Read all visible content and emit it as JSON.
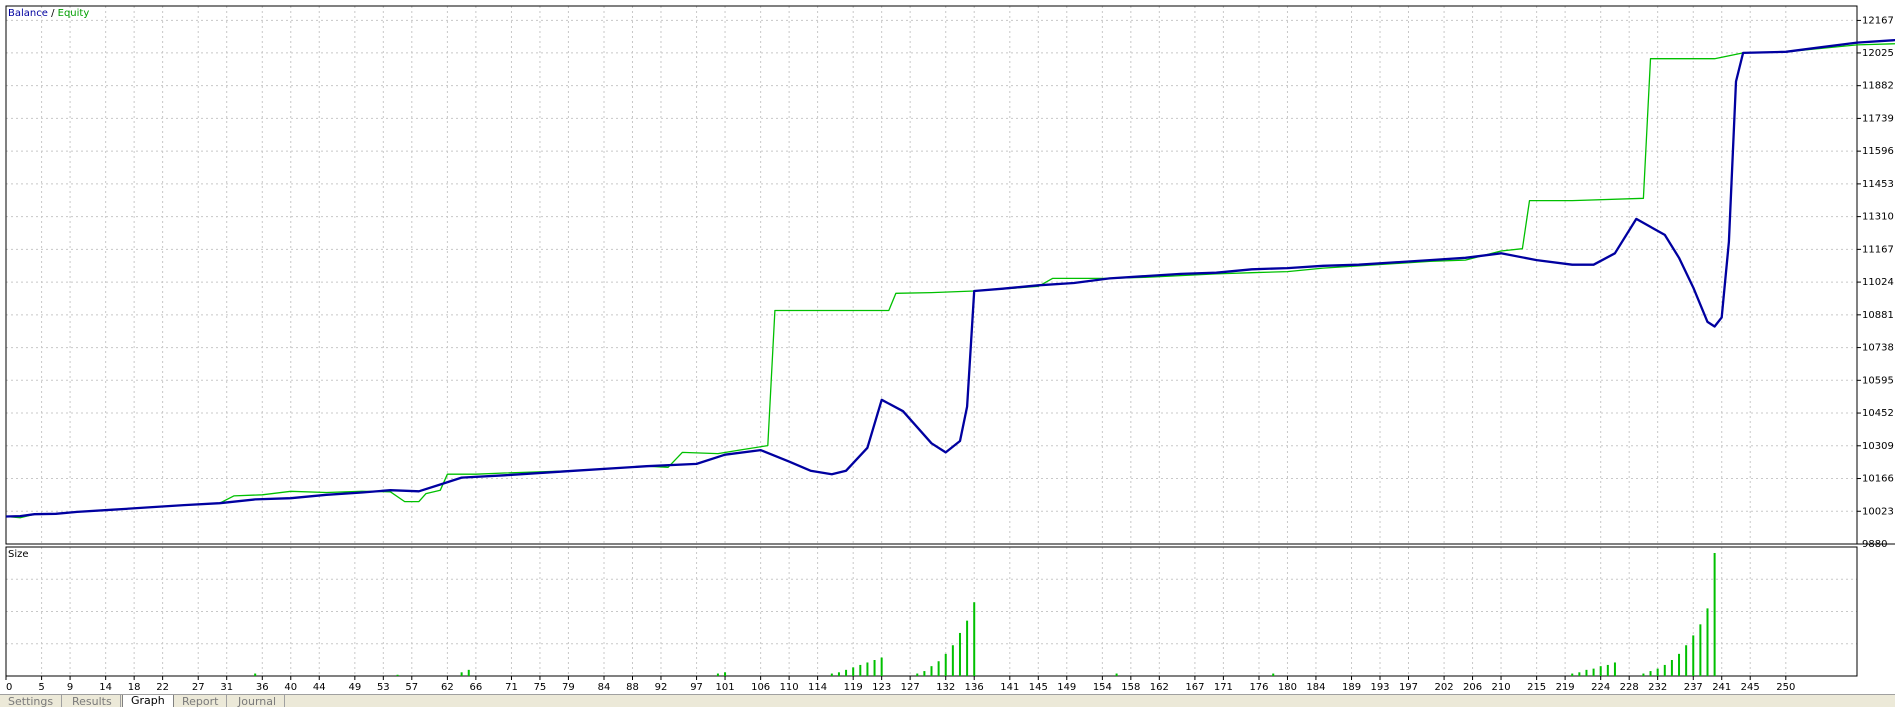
{
  "legend": {
    "balance_label": "Balance",
    "separator": " / ",
    "equity_label": "Equity"
  },
  "size_panel_label": "Size",
  "tabs": [
    {
      "label": "Settings",
      "active": false
    },
    {
      "label": "Results",
      "active": false
    },
    {
      "label": "Graph",
      "active": true
    },
    {
      "label": "Report",
      "active": false
    },
    {
      "label": "Journal",
      "active": false
    }
  ],
  "colors": {
    "balance": "#0000a0",
    "equity": "#00c000",
    "size_bars": "#00c000",
    "grid": "#c8c8c8",
    "axis": "#000000"
  },
  "chart_data": [
    {
      "type": "line",
      "title": "",
      "xlim": [
        0,
        260
      ],
      "ylim": [
        9880,
        12230
      ],
      "y_ticks": [
        9880,
        10023,
        10166,
        10309,
        10452,
        10595,
        10738,
        10881,
        11024,
        11167,
        11310,
        11453,
        11596,
        11739,
        11882,
        12025,
        12167
      ],
      "x_ticks": [
        0,
        5,
        9,
        14,
        18,
        22,
        27,
        31,
        36,
        40,
        44,
        49,
        53,
        57,
        62,
        66,
        71,
        75,
        79,
        84,
        88,
        92,
        97,
        101,
        106,
        110,
        114,
        119,
        123,
        127,
        132,
        136,
        141,
        145,
        149,
        154,
        158,
        162,
        167,
        171,
        176,
        180,
        184,
        189,
        193,
        197,
        202,
        206,
        210,
        215,
        219,
        224,
        228,
        232,
        237,
        241,
        245,
        250
      ],
      "grid": true,
      "legend": "top-left",
      "series": [
        {
          "name": "Balance",
          "points": [
            [
              0,
              10000
            ],
            [
              2,
              10002
            ],
            [
              4,
              10010
            ],
            [
              7,
              10012
            ],
            [
              10,
              10020
            ],
            [
              15,
              10030
            ],
            [
              20,
              10040
            ],
            [
              25,
              10050
            ],
            [
              30,
              10058
            ],
            [
              35,
              10075
            ],
            [
              40,
              10080
            ],
            [
              45,
              10095
            ],
            [
              50,
              10105
            ],
            [
              54,
              10115
            ],
            [
              58,
              10110
            ],
            [
              61,
              10140
            ],
            [
              64,
              10170
            ],
            [
              70,
              10180
            ],
            [
              80,
              10200
            ],
            [
              90,
              10220
            ],
            [
              97,
              10230
            ],
            [
              101,
              10270
            ],
            [
              106,
              10290
            ],
            [
              110,
              10240
            ],
            [
              113,
              10200
            ],
            [
              116,
              10185
            ],
            [
              118,
              10200
            ],
            [
              121,
              10300
            ],
            [
              123,
              10510
            ],
            [
              126,
              10460
            ],
            [
              130,
              10320
            ],
            [
              132,
              10280
            ],
            [
              134,
              10330
            ],
            [
              135,
              10480
            ],
            [
              136,
              10985
            ],
            [
              140,
              10995
            ],
            [
              145,
              11010
            ],
            [
              150,
              11020
            ],
            [
              155,
              11040
            ],
            [
              160,
              11050
            ],
            [
              165,
              11060
            ],
            [
              170,
              11065
            ],
            [
              175,
              11080
            ],
            [
              180,
              11085
            ],
            [
              185,
              11095
            ],
            [
              190,
              11100
            ],
            [
              195,
              11110
            ],
            [
              200,
              11120
            ],
            [
              205,
              11130
            ],
            [
              210,
              11150
            ],
            [
              215,
              11120
            ],
            [
              220,
              11100
            ],
            [
              223,
              11100
            ],
            [
              226,
              11150
            ],
            [
              229,
              11300
            ],
            [
              233,
              11230
            ],
            [
              235,
              11130
            ],
            [
              237,
              11000
            ],
            [
              239,
              10850
            ],
            [
              240,
              10830
            ],
            [
              241,
              10870
            ],
            [
              242,
              11200
            ],
            [
              243,
              11900
            ],
            [
              244,
              12025
            ],
            [
              250,
              12030
            ],
            [
              255,
              12050
            ],
            [
              260,
              12070
            ],
            [
              265,
              12080
            ],
            [
              270,
              12090
            ],
            [
              275,
              12100
            ]
          ]
        },
        {
          "name": "Equity",
          "points": [
            [
              0,
              10000
            ],
            [
              2,
              9995
            ],
            [
              4,
              10010
            ],
            [
              7,
              10012
            ],
            [
              10,
              10020
            ],
            [
              15,
              10030
            ],
            [
              20,
              10040
            ],
            [
              25,
              10050
            ],
            [
              30,
              10058
            ],
            [
              32,
              10090
            ],
            [
              36,
              10095
            ],
            [
              40,
              10110
            ],
            [
              45,
              10105
            ],
            [
              50,
              10110
            ],
            [
              54,
              10108
            ],
            [
              56,
              10065
            ],
            [
              58,
              10065
            ],
            [
              59,
              10100
            ],
            [
              61,
              10115
            ],
            [
              62,
              10185
            ],
            [
              66,
              10185
            ],
            [
              70,
              10190
            ],
            [
              80,
              10200
            ],
            [
              90,
              10220
            ],
            [
              93,
              10215
            ],
            [
              95,
              10280
            ],
            [
              100,
              10275
            ],
            [
              103,
              10290
            ],
            [
              107,
              10310
            ],
            [
              108,
              10900
            ],
            [
              115,
              10900
            ],
            [
              120,
              10900
            ],
            [
              124,
              10900
            ],
            [
              125,
              10975
            ],
            [
              130,
              10978
            ],
            [
              136,
              10985
            ],
            [
              145,
              11005
            ],
            [
              147,
              11040
            ],
            [
              155,
              11040
            ],
            [
              160,
              11045
            ],
            [
              170,
              11060
            ],
            [
              175,
              11065
            ],
            [
              180,
              11070
            ],
            [
              185,
              11085
            ],
            [
              190,
              11095
            ],
            [
              195,
              11105
            ],
            [
              200,
              11115
            ],
            [
              205,
              11120
            ],
            [
              210,
              11160
            ],
            [
              213,
              11170
            ],
            [
              214,
              11380
            ],
            [
              220,
              11380
            ],
            [
              230,
              11390
            ],
            [
              231,
              12000
            ],
            [
              240,
              12000
            ],
            [
              244,
              12025
            ],
            [
              250,
              12030
            ],
            [
              255,
              12045
            ],
            [
              260,
              12060
            ],
            [
              265,
              12065
            ],
            [
              270,
              12070
            ],
            [
              273,
              12080
            ],
            [
              275,
              12045
            ],
            [
              277,
              12020
            ],
            [
              280,
              12040
            ]
          ]
        }
      ]
    },
    {
      "type": "bar",
      "title": "Size",
      "ylim": [
        0,
        1
      ],
      "series": [
        {
          "name": "Size",
          "values": [
            [
              35,
              0.02
            ],
            [
              55,
              0.01
            ],
            [
              64,
              0.03
            ],
            [
              65,
              0.05
            ],
            [
              100,
              0.02
            ],
            [
              101,
              0.03
            ],
            [
              116,
              0.02
            ],
            [
              117,
              0.03
            ],
            [
              118,
              0.05
            ],
            [
              119,
              0.07
            ],
            [
              120,
              0.09
            ],
            [
              121,
              0.11
            ],
            [
              122,
              0.13
            ],
            [
              123,
              0.15
            ],
            [
              128,
              0.02
            ],
            [
              129,
              0.04
            ],
            [
              130,
              0.08
            ],
            [
              131,
              0.12
            ],
            [
              132,
              0.18
            ],
            [
              133,
              0.25
            ],
            [
              134,
              0.35
            ],
            [
              135,
              0.45
            ],
            [
              136,
              0.6
            ],
            [
              156,
              0.02
            ],
            [
              178,
              0.02
            ],
            [
              220,
              0.02
            ],
            [
              221,
              0.03
            ],
            [
              222,
              0.05
            ],
            [
              223,
              0.06
            ],
            [
              224,
              0.08
            ],
            [
              225,
              0.09
            ],
            [
              226,
              0.11
            ],
            [
              230,
              0.02
            ],
            [
              231,
              0.04
            ],
            [
              232,
              0.06
            ],
            [
              233,
              0.09
            ],
            [
              234,
              0.13
            ],
            [
              235,
              0.18
            ],
            [
              236,
              0.25
            ],
            [
              237,
              0.33
            ],
            [
              238,
              0.42
            ],
            [
              239,
              0.55
            ],
            [
              240,
              1.0
            ]
          ]
        }
      ]
    }
  ]
}
